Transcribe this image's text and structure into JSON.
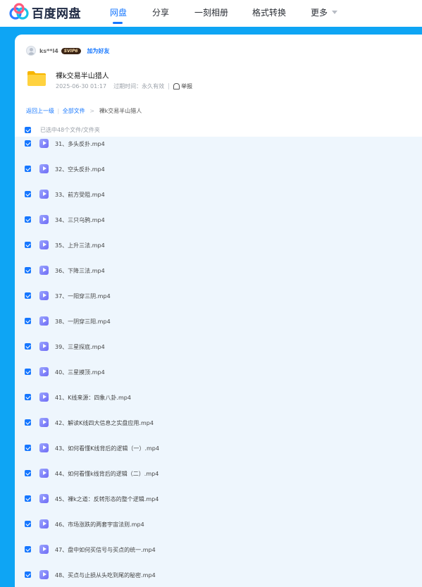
{
  "header": {
    "logo_text": "百度网盘",
    "nav": [
      {
        "label": "网盘",
        "active": true
      },
      {
        "label": "分享",
        "active": false
      },
      {
        "label": "一刻相册",
        "active": false
      },
      {
        "label": "格式转换",
        "active": false
      },
      {
        "label": "更多",
        "active": false
      }
    ]
  },
  "share": {
    "owner": "ks**l4",
    "vip_badge": "SVIP6",
    "add_friend": "加为好友",
    "title": "裸k交易半山猎人",
    "created": "2025-06-30 01:17",
    "expire_label": "过期时间：永久有效",
    "report": "举报"
  },
  "breadcrumb": {
    "back": "返回上一级",
    "separator": "|",
    "all_files": "全部文件",
    "arrow": ">",
    "current": "裸k交易半山猎人"
  },
  "selection": {
    "label": "已选中48个文件/文件夹"
  },
  "files": [
    "31、多头反扑.mp4",
    "32、空头反扑.mp4",
    "33、前方受阻.mp4",
    "34、三只乌鸦.mp4",
    "35、上升三法.mp4",
    "36、下降三法.mp4",
    "37、一阳穿三阴.mp4",
    "38、一阴穿三阳.mp4",
    "39、三星探底.mp4",
    "40、三星摸顶.mp4",
    "41、K线来源：四象八卦.mp4",
    "42、解读K线四大信息之实盘应用.mp4",
    "43、如何看懂K线背后的逻辑（一）.mp4",
    "44、如何看懂k线背后的逻辑（二）.mp4",
    "45、裸k之道：反转形态的整个逻辑.mp4",
    "46、市场涨跌的两套宇宙法则.mp4",
    "47、盘中如何买信号与买点的统一.mp4",
    "48、买点与止损从头吃到尾的秘密.mp4"
  ]
}
